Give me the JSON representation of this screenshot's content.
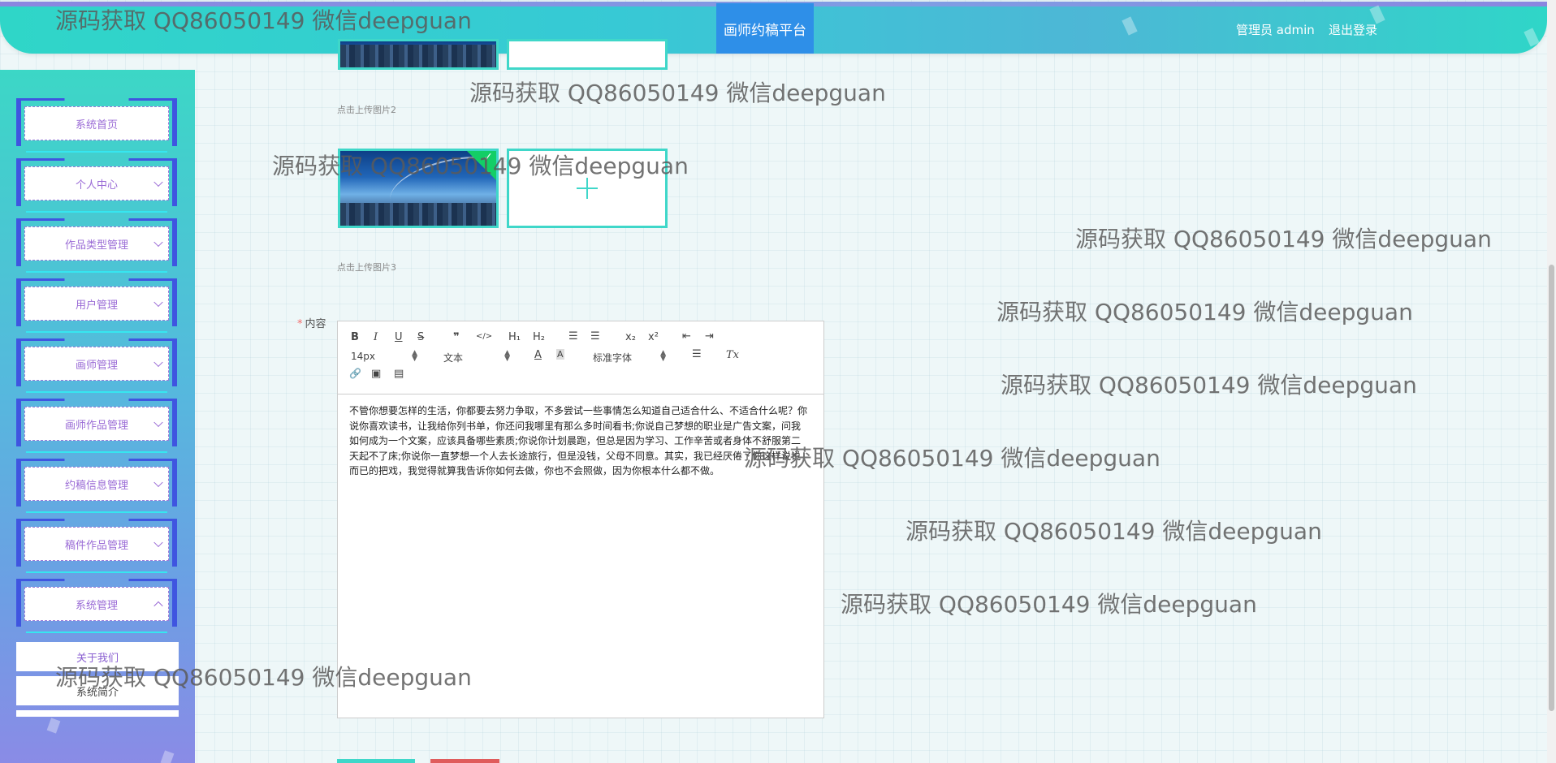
{
  "header": {
    "title": "画师约稿平台",
    "user_label": "管理员 admin",
    "logout_label": "退出登录"
  },
  "sidebar": {
    "items": [
      {
        "label": "系统首页"
      },
      {
        "label": "个人中心"
      },
      {
        "label": "作品类型管理"
      },
      {
        "label": "用户管理"
      },
      {
        "label": "画师管理"
      },
      {
        "label": "画师作品管理"
      },
      {
        "label": "约稿信息管理"
      },
      {
        "label": "稿件作品管理"
      },
      {
        "label": "系统管理"
      }
    ],
    "submenu": [
      {
        "label": "关于我们"
      },
      {
        "label": "系统简介"
      }
    ]
  },
  "form": {
    "upload2_hint": "点击上传图片2",
    "upload3_hint": "点击上传图片3",
    "content_label": "内容"
  },
  "editor": {
    "toolbar": {
      "bold": "B",
      "italic": "I",
      "underline": "U",
      "strike": "S",
      "quote": "❞",
      "code": "</>",
      "h1": "H₁",
      "h2": "H₂",
      "ordered": "☰",
      "bullet": "☰",
      "sub": "x₂",
      "sup": "x²",
      "outdent": "⇤",
      "indent": "⇥",
      "size": "14px",
      "header": "文本",
      "color": "A",
      "background": "A",
      "font": "标准字体",
      "align": "☰",
      "clean": "Tx",
      "link": "🔗",
      "image": "▣",
      "video": "▤"
    },
    "content": "不管你想要怎样的生活，你都要去努力争取，不多尝试一些事情怎么知道自己适合什么、不适合什么呢？你说你喜欢读书，让我给你列书单，你还问我哪里有那么多时间看书;你说自己梦想的职业是广告文案，问我如何成为一个文案，应该具备哪些素质;你说你计划晨跑，但总是因为学习、工作辛苦或者身体不舒服第二天起不了床;你说你一直梦想一个人去长途旅行，但是没钱，父母不同意。其实，我已经厌倦了你这样说说而已的把戏，我觉得就算我告诉你如何去做，你也不会照做，因为你根本什么都不做。"
  },
  "watermark": "源码获取 QQ86050149 微信deepguan",
  "colors": {
    "accent": "#3fd7c9",
    "header_title_bg": "#2e8fe8",
    "menu_text": "#9a6bd6",
    "required": "#f56c6c"
  }
}
